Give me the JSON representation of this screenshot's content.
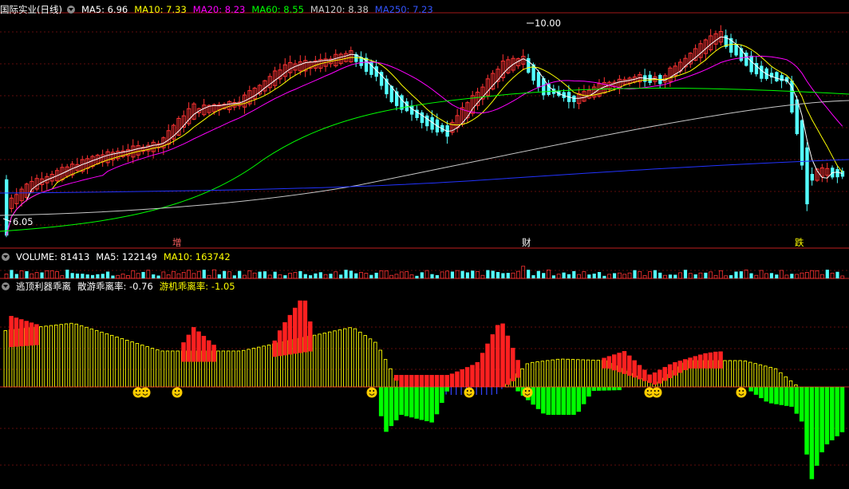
{
  "main_panel": {
    "stock_name": "国际实业(日线)",
    "ma_items": [
      {
        "label": "MA5: 6.96",
        "color": "#ffffff"
      },
      {
        "label": "MA10: 7.33",
        "color": "#ffff00"
      },
      {
        "label": "MA20: 8.23",
        "color": "#ff00ff"
      },
      {
        "label": "MA60: 8.55",
        "color": "#00ff00"
      },
      {
        "label": "MA120: 8.38",
        "color": "#c8c8c8"
      },
      {
        "label": "MA250: 7.23",
        "color": "#3355ff"
      }
    ],
    "high_label": "10.00",
    "low_label": "6.05",
    "events": [
      {
        "label": "增",
        "color": "#ff6060"
      },
      {
        "label": "财",
        "color": "#ffffff"
      },
      {
        "label": "跌",
        "color": "#ffff00"
      }
    ]
  },
  "volume_panel": {
    "items": [
      {
        "label": "VOLUME: 81413",
        "color": "#ffffff"
      },
      {
        "label": "MA5: 122149",
        "color": "#ffffff"
      },
      {
        "label": "MA10: 163742",
        "color": "#ffff00"
      }
    ]
  },
  "indicator_panel": {
    "items": [
      {
        "label": "逃顶利器乖离",
        "color": "#ffffff"
      },
      {
        "label": "散游乖离率: -0.76",
        "color": "#ffffff"
      },
      {
        "label": "游机乖离率: -1.05",
        "color": "#ffff00"
      }
    ]
  },
  "colors": {
    "up": "#ff3333",
    "down": "#54ffff",
    "ma5": "#ffffff",
    "ma10": "#ffff00",
    "ma20": "#ff00ff",
    "ma60": "#00ff00",
    "ma120": "#c8c8c8",
    "ma250": "#2233ff",
    "grid": "#801010",
    "bull": "#ff2020",
    "bear": "#00ff00",
    "yellow_bar": "#ffff00",
    "blue_bar": "#3344ff",
    "smile": "#ffcc00"
  }
}
